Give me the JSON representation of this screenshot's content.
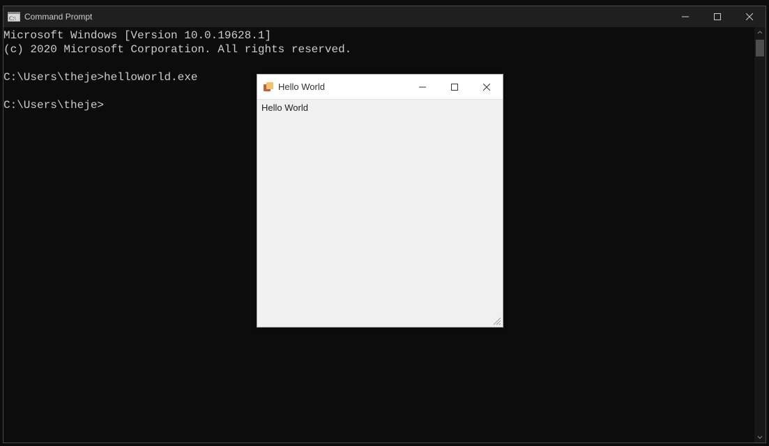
{
  "cmd": {
    "title": "Command Prompt",
    "lines": {
      "l0": "Microsoft Windows [Version 10.0.19628.1]",
      "l1": "(c) 2020 Microsoft Corporation. All rights reserved.",
      "l2": "",
      "l3": "C:\\Users\\theje>helloworld.exe",
      "l4": "",
      "l5": "C:\\Users\\theje>"
    }
  },
  "child": {
    "title": "Hello World",
    "body_text": "Hello World"
  }
}
